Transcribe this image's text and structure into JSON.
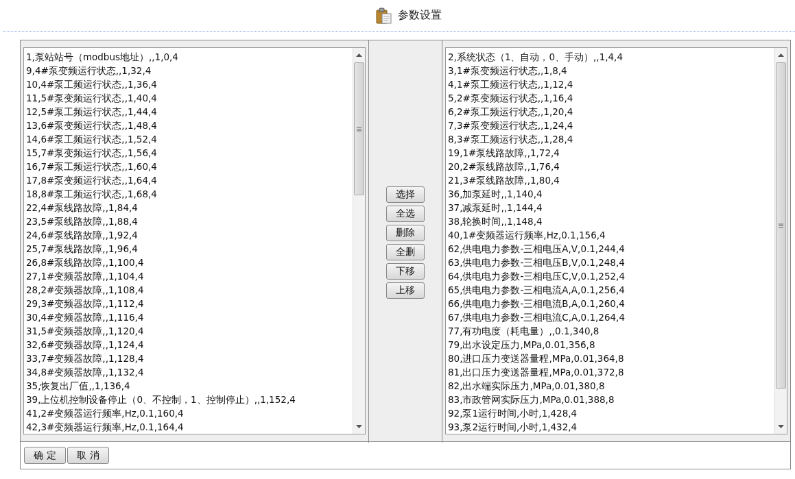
{
  "title": "参数设置",
  "left_list": {
    "items": [
      "1,泵站站号（modbus地址）,,1,0,4",
      "9,4#泵变频运行状态,,1,32,4",
      "10,4#泵工频运行状态,,1,36,4",
      "11,5#泵变频运行状态,,1,40,4",
      "12,5#泵工频运行状态,,1,44,4",
      "13,6#泵变频运行状态,,1,48,4",
      "14,6#泵工频运行状态,,1,52,4",
      "15,7#泵变频运行状态,,1,56,4",
      "16,7#泵工频运行状态,,1,60,4",
      "17,8#泵变频运行状态,,1,64,4",
      "18,8#泵工频运行状态,,1,68,4",
      "22,4#泵线路故障,,1,84,4",
      "23,5#泵线路故障,,1,88,4",
      "24,6#泵线路故障,,1,92,4",
      "25,7#泵线路故障,,1,96,4",
      "26,8#泵线路故障,,1,100,4",
      "27,1#变频器故障,,1,104,4",
      "28,2#变频器故障,,1,108,4",
      "29,3#变频器故障,,1,112,4",
      "30,4#变频器故障,,1,116,4",
      "31,5#变频器故障,,1,120,4",
      "32,6#变频器故障,,1,124,4",
      "33,7#变频器故障,,1,128,4",
      "34,8#变频器故障,,1,132,4",
      "35,恢复出厂值,,1,136,4",
      "39,上位机控制设备停止（0、不控制，1、控制停止）,,1,152,4",
      "41,2#变频器运行频率,Hz,0.1,160,4",
      "42,3#变频器运行频率,Hz,0.1,164,4"
    ]
  },
  "middle_buttons": [
    "选择",
    "全选",
    "删除",
    "全删",
    "下移",
    "上移"
  ],
  "right_list": {
    "items": [
      "2,系统状态（1、自动，0、手动）,,1,4,4",
      "3,1#泵变频运行状态,,1,8,4",
      "4,1#泵工频运行状态,,1,12,4",
      "5,2#泵变频运行状态,,1,16,4",
      "6,2#泵工频运行状态,,1,20,4",
      "7,3#泵变频运行状态,,1,24,4",
      "8,3#泵工频运行状态,,1,28,4",
      "19,1#泵线路故障,,1,72,4",
      "20,2#泵线路故障,,1,76,4",
      "21,3#泵线路故障,,1,80,4",
      "36,加泵延时,,1,140,4",
      "37,减泵延时,,1,144,4",
      "38,轮换时间,,1,148,4",
      "40,1#变频器运行频率,Hz,0.1,156,4",
      "62,供电电力参数-三相电压A,V,0.1,244,4",
      "63,供电电力参数-三相电压B,V,0.1,248,4",
      "64,供电电力参数-三相电压C,V,0.1,252,4",
      "65,供电电力参数-三相电流A,A,0.1,256,4",
      "66,供电电力参数-三相电流B,A,0.1,260,4",
      "67,供电电力参数-三相电流C,A,0.1,264,4",
      "77,有功电度（耗电量）,,0.1,340,8",
      "79,出水设定压力,MPa,0.01,356,8",
      "80,进口压力变送器量程,MPa,0.01,364,8",
      "81,出口压力变送器量程,MPa,0.01,372,8",
      "82,出水端实际压力,MPa,0.01,380,8",
      "83,市政管网实际压力,MPa,0.01,388,8",
      "92,泵1运行时间,小时,1,428,4",
      "93,泵2运行时间,小时,1,432,4"
    ]
  },
  "footer_buttons": [
    "确 定",
    "取 消"
  ]
}
